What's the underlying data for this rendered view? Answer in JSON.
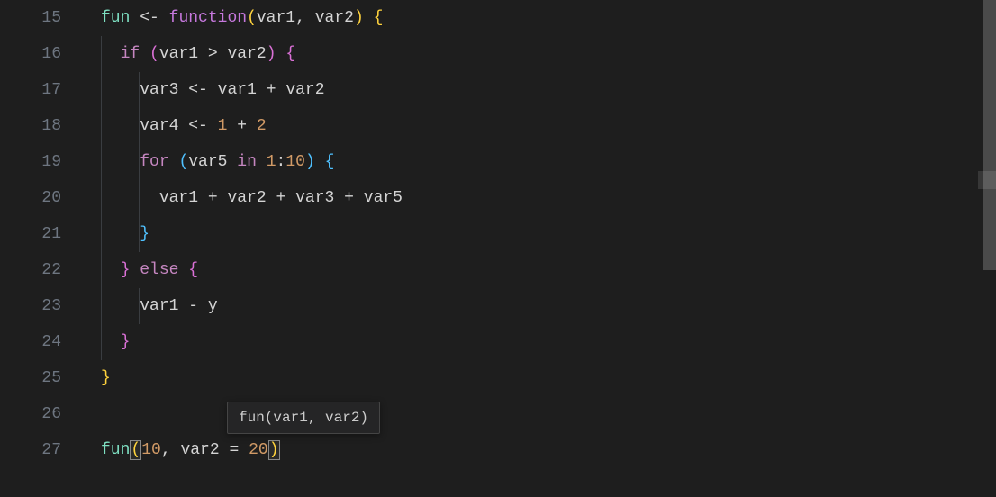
{
  "gutter": {
    "start": 15,
    "end": 27
  },
  "signature_help": "fun(var1, var2)",
  "tokens": {
    "fun_name": "fun",
    "arrow": "<-",
    "function_kw": "function",
    "lparen": "(",
    "rparen": ")",
    "lbrace": "{",
    "rbrace": "}",
    "comma": ",",
    "var1": "var1",
    "var2": "var2",
    "var3": "var3",
    "var4": "var4",
    "var5": "var5",
    "if_kw": "if",
    "else_kw": "else",
    "for_kw": "for",
    "in_kw": "in",
    "gt": ">",
    "plus": "+",
    "minus": "-",
    "colon": ":",
    "eq": "=",
    "y": "y",
    "n1": "1",
    "n2": "2",
    "n10": "10",
    "n20": "20"
  }
}
